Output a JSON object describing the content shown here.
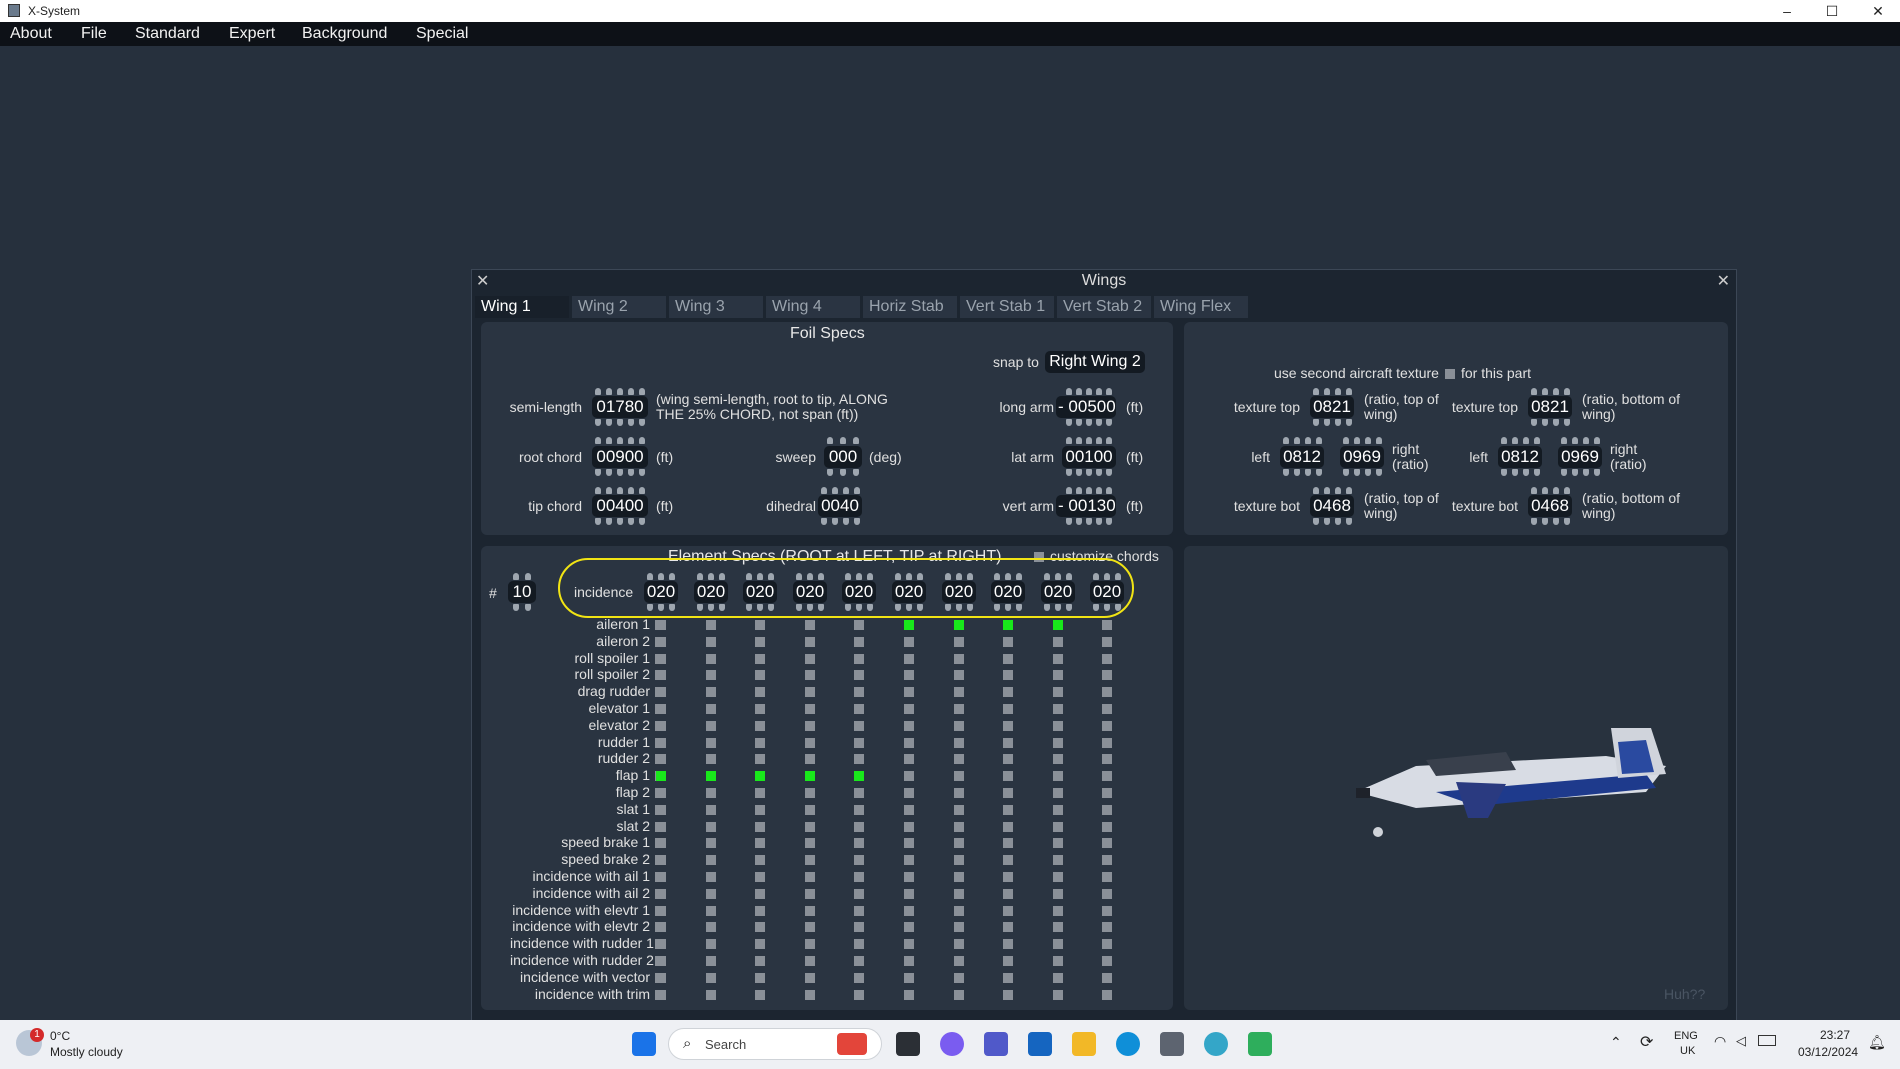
{
  "window": {
    "title": "X-System"
  },
  "menu": [
    "About",
    "File",
    "Standard",
    "Expert",
    "Background",
    "Special"
  ],
  "wings": {
    "title": "Wings",
    "tabs": [
      "Wing 1",
      "Wing 2",
      "Wing 3",
      "Wing 4",
      "Horiz Stab",
      "Vert Stab 1",
      "Vert Stab 2",
      "Wing Flex"
    ],
    "active_tab": "Wing 1",
    "foil": {
      "title": "Foil Specs",
      "snap_label": "snap to",
      "snap_value": "Right Wing 2",
      "semi_length": {
        "label": "semi-length",
        "value": "01780",
        "note": "(wing semi-length, root to tip, ALONG THE 25% CHORD, not span (ft))"
      },
      "root_chord": {
        "label": "root chord",
        "value": "00900",
        "unit": "(ft)"
      },
      "tip_chord": {
        "label": "tip chord",
        "value": "00400",
        "unit": "(ft)"
      },
      "sweep": {
        "label": "sweep",
        "value": "000",
        "unit": "(deg)"
      },
      "dihedral": {
        "label": "dihedral",
        "value": "0040"
      },
      "long_arm": {
        "label": "long arm",
        "sign": "-",
        "value": "00500",
        "unit": "(ft)"
      },
      "lat_arm": {
        "label": "lat arm",
        "value": "00100",
        "unit": "(ft)"
      },
      "vert_arm": {
        "label": "vert arm",
        "sign": "-",
        "value": "00130",
        "unit": "(ft)"
      }
    },
    "texture": {
      "second_texture_label": "use second aircraft texture",
      "for_this_part": "for this part",
      "top": {
        "texture_top_label": "texture top",
        "texture_top": "0821",
        "texture_top_note": "(ratio, top of wing)",
        "left_label": "left",
        "left": "0812",
        "right": "0969",
        "right_note": "right (ratio)",
        "texture_bot_label": "texture bot",
        "texture_bot": "0468",
        "texture_bot_note": "(ratio, top of wing)"
      },
      "bottom": {
        "texture_top_label": "texture top",
        "texture_top": "0821",
        "texture_top_note": "(ratio, bottom of wing)",
        "left_label": "left",
        "left": "0812",
        "right": "0969",
        "right_note": "right (ratio)",
        "texture_bot_label": "texture bot",
        "texture_bot": "0468",
        "texture_bot_note": "(ratio, bottom of wing)"
      }
    },
    "elements": {
      "title": "Element Specs (ROOT at LEFT, TIP at RIGHT)",
      "customize_chords": "customize chords",
      "count_label": "#",
      "count": "10",
      "incidence_label": "incidence",
      "incidence": [
        "020",
        "020",
        "020",
        "020",
        "020",
        "020",
        "020",
        "020",
        "020",
        "020"
      ],
      "rows": [
        "aileron 1",
        "aileron 2",
        "roll spoiler 1",
        "roll spoiler 2",
        "drag rudder",
        "elevator 1",
        "elevator 2",
        "rudder 1",
        "rudder 2",
        "flap 1",
        "flap 2",
        "slat 1",
        "slat 2",
        "speed brake 1",
        "speed brake 2",
        "incidence with ail 1",
        "incidence with ail 2",
        "incidence with elevtr 1",
        "incidence with elevtr 2",
        "incidence with rudder 1",
        "incidence with rudder 2",
        "incidence with vector",
        "incidence with trim"
      ],
      "checked": {
        "aileron 1": [
          6,
          7,
          8,
          9
        ],
        "flap 1": [
          1,
          2,
          3,
          4,
          5
        ]
      }
    },
    "huh_button": "Huh??"
  },
  "taskbar": {
    "weather_temp": "0°C",
    "weather_desc": "Mostly cloudy",
    "weather_badge": "1",
    "search_placeholder": "Search",
    "lang": "ENG",
    "region": "UK",
    "time": "23:27",
    "date": "03/12/2024"
  }
}
